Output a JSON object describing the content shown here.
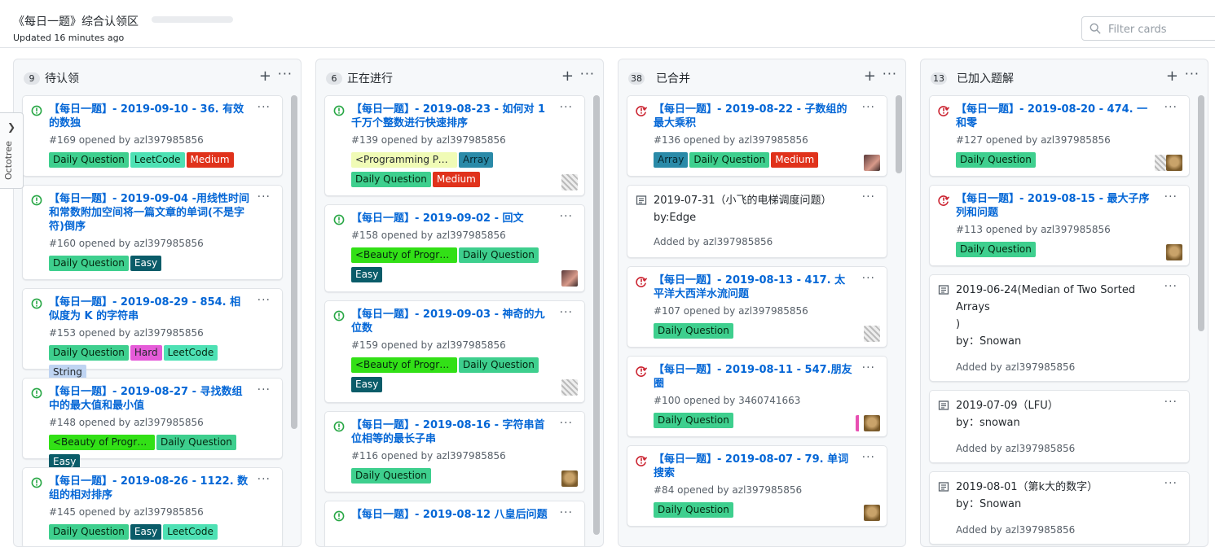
{
  "header": {
    "title": "《每日一题》综合认领区",
    "updated": "Updated 16 minutes ago",
    "filter_placeholder": "Filter cards"
  },
  "octotree": {
    "label": "Octotree"
  },
  "columns": [
    {
      "count": "9",
      "title": "待认领",
      "cards": [
        {
          "title": "【每日一题】- 2019-09-10 - 36. 有效的数独",
          "meta": "#169 opened by azl397985856",
          "labels": [
            "Daily Question",
            "LeetCode",
            "Medium"
          ]
        },
        {
          "title": "【每日一题】- 2019-09-04 -用线性时间和常数附加空间将一篇文章的单词(不是字符)倒序",
          "meta": "#160 opened by azl397985856",
          "labels": [
            "Daily Question",
            "Easy"
          ]
        },
        {
          "title": "【每日一题】- 2019-08-29 - 854. 相似度为 K 的字符串",
          "meta": "#153 opened by azl397985856",
          "labels": [
            "Daily Question",
            "Hard",
            "LeetCode",
            "String"
          ]
        },
        {
          "title": "【每日一题】- 2019-08-27 - 寻找数组中的最大值和最小值",
          "meta": "#148 opened by azl397985856",
          "labels": [
            "<Beauty of Progra…",
            "Daily Question",
            "Easy"
          ]
        },
        {
          "title": "【每日一题】- 2019-08-26 - 1122. 数组的相对排序",
          "meta": "#145 opened by azl397985856",
          "labels": [
            "Daily Question",
            "Easy",
            "LeetCode"
          ]
        }
      ]
    },
    {
      "count": "6",
      "title": "正在进行",
      "cards": [
        {
          "title": "【每日一题】- 2019-08-23 - 如何对 1 千万个整数进行快速排序",
          "meta": "#139 opened by azl397985856",
          "labels": [
            "<Programming Pea…",
            "Array",
            "Daily Question",
            "Medium"
          ]
        },
        {
          "title": "【每日一题】- 2019-09-02 - 回文",
          "meta": "#158 opened by azl397985856",
          "labels": [
            "<Beauty of Progra…",
            "Daily Question",
            "Easy"
          ]
        },
        {
          "title": "【每日一题】- 2019-09-03 - 神奇的九位数",
          "meta": "#159 opened by azl397985856",
          "labels": [
            "<Beauty of Progra…",
            "Daily Question",
            "Easy"
          ]
        },
        {
          "title": "【每日一题】- 2019-08-16 - 字符串首位相等的最长子串",
          "meta": "#116 opened by azl397985856",
          "labels": [
            "Daily Question"
          ]
        },
        {
          "title": "【每日一题】- 2019-08-12 八皇后问题",
          "meta": "",
          "labels": []
        }
      ]
    },
    {
      "count": "38",
      "title": "已合并",
      "cards": [
        {
          "title": "【每日一题】- 2019-08-22 - 子数组的最大乘积",
          "meta": "#136 opened by azl397985856",
          "labels": [
            "Array",
            "Daily Question",
            "Medium"
          ]
        },
        {
          "note": "2019-07-31（小飞的电梯调度问题）\nby:Edge",
          "added": "Added by azl397985856"
        },
        {
          "title": "【每日一题】- 2019-08-13 - 417. 太平洋大西洋水流问题",
          "meta": "#107 opened by azl397985856",
          "labels": [
            "Daily Question"
          ]
        },
        {
          "title": "【每日一题】- 2019-08-11 - 547.朋友圈",
          "meta": "#100 opened by 3460741663",
          "labels": [
            "Daily Question"
          ]
        },
        {
          "title": "【每日一题】- 2019-08-07 - 79. 单词搜索",
          "meta": "#84 opened by azl397985856",
          "labels": [
            "Daily Question"
          ]
        }
      ]
    },
    {
      "count": "13",
      "title": "已加入题解",
      "cards": [
        {
          "title": "【每日一题】- 2019-08-20 - 474. 一和零",
          "meta": "#127 opened by azl397985856",
          "labels": [
            "Daily Question"
          ]
        },
        {
          "title": "【每日一题】- 2019-08-15 - 最大子序列和问题",
          "meta": "#113 opened by azl397985856",
          "labels": [
            "Daily Question"
          ]
        },
        {
          "note": "2019-06-24(Median of Two Sorted Arrays\n)\nby：Snowan",
          "added": "Added by azl397985856"
        },
        {
          "note": "2019-07-09（LFU）\nby：snowan",
          "added": "Added by azl397985856"
        },
        {
          "note": "2019-08-01（第k大的数字）\nby：Snowan",
          "added": "Added by azl397985856"
        }
      ]
    }
  ],
  "colors": {
    "link": "#0366d6",
    "open": "#28a745",
    "merged": "#cb2431"
  }
}
